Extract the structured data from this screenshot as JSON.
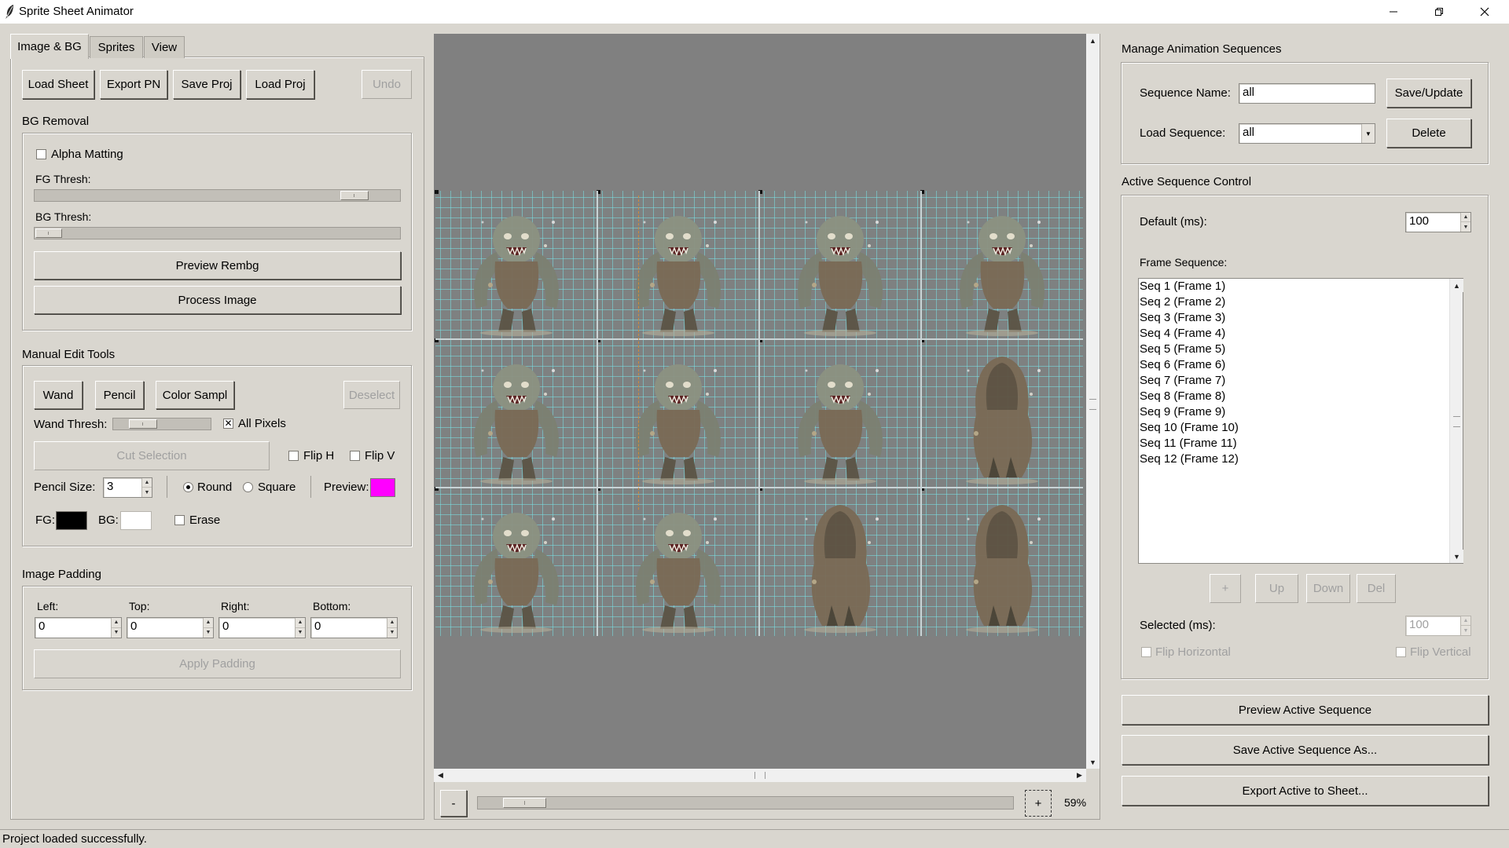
{
  "window": {
    "title": "Sprite Sheet Animator"
  },
  "left_panel": {
    "tabs": [
      "Image & BG",
      "Sprites",
      "View"
    ],
    "toolbar": [
      "Load Sheet",
      "Export PN",
      "Save Proj",
      "Load Proj",
      "Undo"
    ],
    "bg_removal": {
      "label": "BG Removal",
      "alpha_matting": "Alpha Matting",
      "fg_thresh": "FG Thresh:",
      "fg_thresh_value": 0.87,
      "bg_thresh": "BG Thresh:",
      "bg_thresh_value": 0.05,
      "preview_button": "Preview Rembg",
      "process_button": "Process Image"
    },
    "manual_edit": {
      "label": "Manual Edit Tools",
      "tools": [
        "Wand",
        "Pencil",
        "Color Sampl",
        "Deselect"
      ],
      "wand_thresh": "Wand Thresh:",
      "wand_thresh_value": 0.3,
      "all_pixels": "All Pixels",
      "cut_selection": "Cut Selection",
      "flip_h": "Flip H",
      "flip_v": "Flip V",
      "pencil_size_label": "Pencil Size:",
      "pencil_size": "3",
      "round": "Round",
      "square": "Square",
      "preview_label": "Preview:",
      "preview_color": "#ff00ff",
      "fg_label": "FG:",
      "fg_color": "#000000",
      "bg_label": "BG:",
      "bg_color": "#ffffff",
      "erase": "Erase"
    },
    "padding": {
      "label": "Image Padding",
      "fields": [
        {
          "label": "Left:",
          "value": "0"
        },
        {
          "label": "Top:",
          "value": "0"
        },
        {
          "label": "Right:",
          "value": "0"
        },
        {
          "label": "Bottom:",
          "value": "0"
        }
      ],
      "apply": "Apply Padding"
    }
  },
  "canvas": {
    "zoom_minus": "-",
    "zoom_plus": "+",
    "zoom_percent": "59%",
    "zoom_value": 0.05,
    "grid_rows": 3,
    "grid_cols": 4
  },
  "right_panel": {
    "manage": {
      "label": "Manage Animation Sequences",
      "name_label": "Sequence Name:",
      "name_value": "all",
      "save_update": "Save/Update",
      "load_label": "Load Sequence:",
      "load_value": "all",
      "delete": "Delete"
    },
    "active": {
      "label": "Active Sequence Control",
      "default_label": "Default (ms):",
      "default_value": "100",
      "frame_seq_label": "Frame Sequence:",
      "frames": [
        "Seq 1 (Frame 1)",
        "Seq 2 (Frame 2)",
        "Seq 3 (Frame 3)",
        "Seq 4 (Frame 4)",
        "Seq 5 (Frame 5)",
        "Seq 6 (Frame 6)",
        "Seq 7 (Frame 7)",
        "Seq 8 (Frame 8)",
        "Seq 9 (Frame 9)",
        "Seq 10 (Frame 10)",
        "Seq 11 (Frame 11)",
        "Seq 12 (Frame 12)"
      ],
      "list_buttons": [
        "+",
        "Up",
        "Down",
        "Del"
      ],
      "selected_label": "Selected (ms):",
      "selected_value": "100",
      "flip_horizontal": "Flip Horizontal",
      "flip_vertical": "Flip Vertical"
    },
    "actions": [
      "Preview Active Sequence",
      "Save Active Sequence As...",
      "Export Active to Sheet..."
    ]
  },
  "status": {
    "text": "Project loaded successfully."
  }
}
